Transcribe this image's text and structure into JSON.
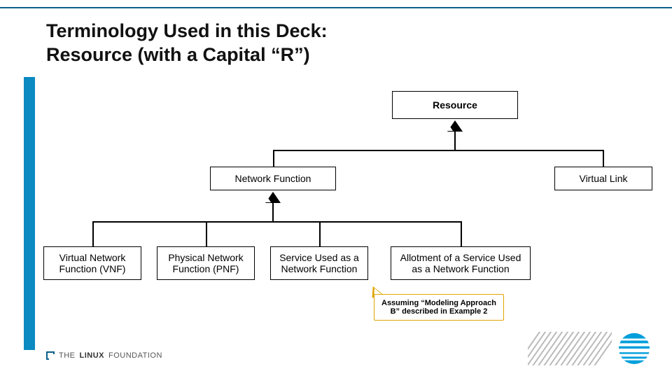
{
  "title_line1": "Terminology Used in this Deck:",
  "title_line2": "Resource (with a Capital “R”)",
  "nodes": {
    "resource": "Resource",
    "network_function": "Network Function",
    "virtual_link": "Virtual Link",
    "vnf": "Virtual Network Function (VNF)",
    "pnf": "Physical Network Function (PNF)",
    "svc_as_nf": "Service Used as a Network Function",
    "allot_svc_nf": "Allotment of a Service Used as a Network Function"
  },
  "callout": "Assuming “Modeling Approach B” described in Example 2",
  "footer": {
    "lf_prefix": "THE",
    "lf_main": "LINUX",
    "lf_suffix": "FOUNDATION"
  },
  "colors": {
    "accent": "#0b8ac2",
    "rule": "#0b5e8a",
    "callout_border": "#e0a400",
    "att_blue": "#009fdb"
  }
}
